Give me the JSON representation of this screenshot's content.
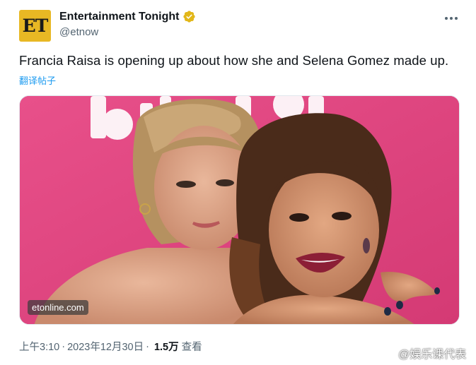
{
  "author": {
    "avatar_text": "ET",
    "display_name": "Entertainment Tonight",
    "handle": "@etnow",
    "verified_icon": "gold-verified-badge-icon"
  },
  "tweet": {
    "text": "Francia Raisa is opening up about how she and Selena Gomez made up.",
    "translate_label": "翻译帖子"
  },
  "media": {
    "source_badge": "etonline.com",
    "backdrop_colors": {
      "pink": "#e0427f",
      "white": "#ffffff"
    }
  },
  "meta": {
    "time": "上午3:10",
    "date": "2023年12月30日",
    "separator": "·",
    "views_count": "1.5万",
    "views_label": "查看"
  },
  "watermark": {
    "text": "@娱乐课代表",
    "icon": "weibo-icon"
  },
  "colors": {
    "link": "#1d9bf0",
    "secondary_text": "#536471",
    "primary_text": "#0f1419",
    "avatar_bg": "#e8b824"
  }
}
